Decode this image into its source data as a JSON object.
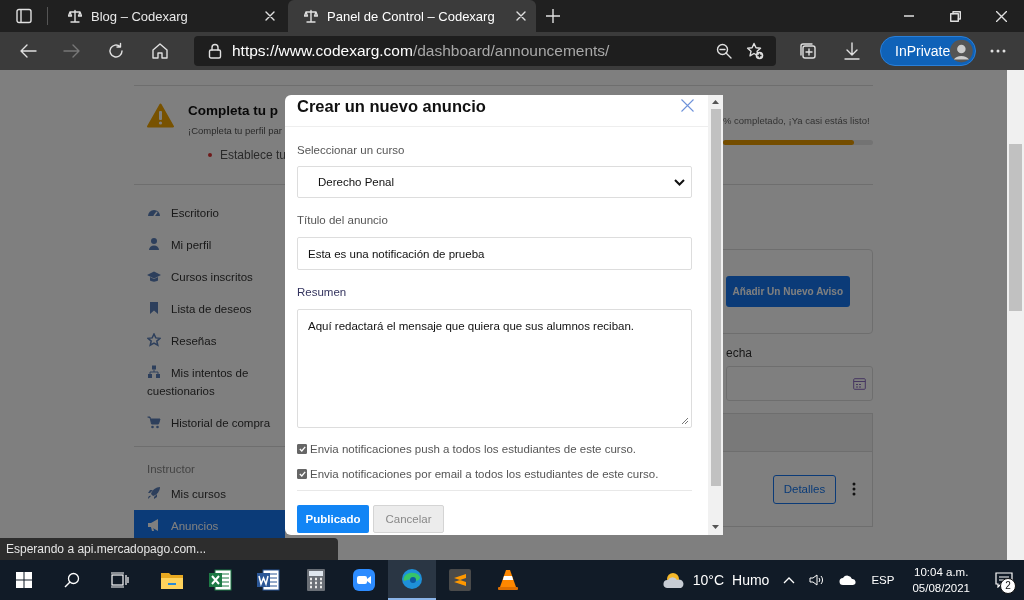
{
  "browser": {
    "tabs": [
      {
        "title": "Blog – Codexarg",
        "selected": false
      },
      {
        "title": "Panel de Control – Codexarg",
        "selected": true
      }
    ],
    "navigation": {
      "forward_disabled": true
    },
    "address": {
      "origin": "https://www.codexarg.com",
      "path": "/dashboard/announcements/"
    },
    "inprivate_label": "InPrivate",
    "status_text": "Esperando a api.mercadopago.com..."
  },
  "profile_notice": {
    "title": "Completa tu p",
    "message": "¡Completa tu perfil par",
    "bullet": "Establece tu",
    "progress_text": "% completado, ¡Ya casi estás listo!",
    "level": 0.87
  },
  "sidebar": {
    "items": [
      {
        "kind": "link",
        "label": "Escritorio",
        "selected": false
      },
      {
        "kind": "link",
        "label": "Mi perfil",
        "selected": false
      },
      {
        "kind": "link",
        "label": "Cursos inscritos",
        "selected": false
      },
      {
        "kind": "link",
        "label": "Lista de deseos",
        "selected": false
      },
      {
        "kind": "link",
        "label": "Reseñas",
        "selected": false
      },
      {
        "kind": "link",
        "label": "Mis intentos de cuestionarios",
        "selected": false
      },
      {
        "kind": "link",
        "label": "Historial de compra",
        "selected": false
      },
      {
        "kind": "heading",
        "label": "Instructor"
      },
      {
        "kind": "link",
        "label": "Mis cursos",
        "selected": false
      },
      {
        "kind": "link",
        "label": "Anuncios",
        "selected": true
      }
    ]
  },
  "announcements": {
    "add_button": "Añadir Un Nuevo Aviso",
    "date_label": "echa",
    "row_button": "Detalles"
  },
  "modal": {
    "title": "Crear un nuevo anuncio",
    "course_label": "Seleccionar un curso",
    "course_value": "Derecho Penal",
    "title_label": "Título del anuncio",
    "title_value": "Esta es una notificación de prueba",
    "summary_label": "Resumen",
    "summary_value": "Aquí redactará el mensaje que quiera que sus alumnos reciban.",
    "options": [
      {
        "label": "Envia notificaciones push a todos los estudiantes de este curso.",
        "checked": true
      },
      {
        "label": "Envia notificaciones por email a todos los estudiantes de este curso.",
        "checked": true
      }
    ],
    "buttons": [
      {
        "label": "Publicado",
        "kind": "primary"
      },
      {
        "label": "Cancelar",
        "kind": "secondary"
      }
    ]
  },
  "taskbar": {
    "apps": [
      {
        "active": false
      },
      {
        "active": false
      },
      {
        "active": false
      },
      {
        "active": false
      },
      {
        "active": false
      },
      {
        "active": false
      },
      {
        "active": false
      },
      {
        "active": false
      },
      {
        "active": true
      },
      {
        "active": false
      },
      {
        "active": false
      }
    ],
    "weather": {
      "temperature": "10°C",
      "condition": "Humo"
    },
    "language": "ESP",
    "time": "10:04 a.m.",
    "date": "05/08/2021",
    "notifications": "2"
  }
}
